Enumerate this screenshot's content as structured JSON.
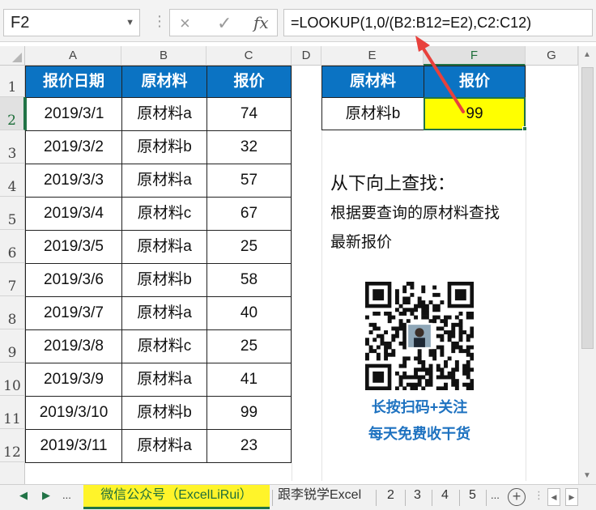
{
  "formula_bar": {
    "name_box": "F2",
    "cancel_icon": "×",
    "enter_icon": "✓",
    "fx_label": "fx",
    "formula": "=LOOKUP(1,0/(B2:B12=E2),C2:C12)"
  },
  "columns": [
    "A",
    "B",
    "C",
    "D",
    "E",
    "F",
    "G"
  ],
  "rows": [
    "1",
    "2",
    "3",
    "4",
    "5",
    "6",
    "7",
    "8",
    "9",
    "10",
    "11",
    "12"
  ],
  "table": {
    "headers": [
      "报价日期",
      "原材料",
      "报价"
    ],
    "rows": [
      [
        "2019/3/1",
        "原材料a",
        "74"
      ],
      [
        "2019/3/2",
        "原材料b",
        "32"
      ],
      [
        "2019/3/3",
        "原材料a",
        "57"
      ],
      [
        "2019/3/4",
        "原材料c",
        "67"
      ],
      [
        "2019/3/5",
        "原材料a",
        "25"
      ],
      [
        "2019/3/6",
        "原材料b",
        "58"
      ],
      [
        "2019/3/7",
        "原材料a",
        "40"
      ],
      [
        "2019/3/8",
        "原材料c",
        "25"
      ],
      [
        "2019/3/9",
        "原材料a",
        "41"
      ],
      [
        "2019/3/10",
        "原材料b",
        "99"
      ],
      [
        "2019/3/11",
        "原材料a",
        "23"
      ]
    ]
  },
  "lookup": {
    "headers": [
      "原材料",
      "报价"
    ],
    "material": "原材料b",
    "result": "99"
  },
  "note": {
    "title": "从下向上查找：",
    "line1": "根据要查询的原材料查找",
    "line2": "最新报价"
  },
  "qr": {
    "caption1": "长按扫码+关注",
    "caption2": "每天免费收干货"
  },
  "sheet_tabs": {
    "ellipsis": "...",
    "tabs": [
      "微信公众号（ExcelLiRui）",
      "跟李锐学Excel",
      "2",
      "3",
      "4",
      "5"
    ],
    "more": "...",
    "add": "+"
  },
  "colors": {
    "header_blue": "#0b73c3",
    "highlight_yellow": "#ffff00",
    "excel_green": "#217346",
    "arrow_red": "#e8413c",
    "qr_text_blue": "#1e72c0"
  }
}
